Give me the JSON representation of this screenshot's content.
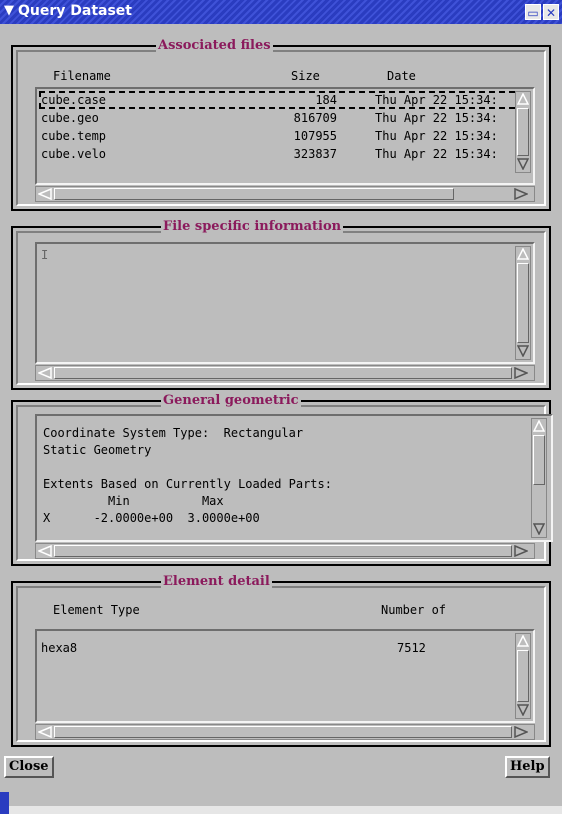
{
  "window": {
    "title": "Query Dataset",
    "minimize_glyph": "▭",
    "close_glyph": "✕",
    "menu_glyph": "▼"
  },
  "assoc": {
    "legend": "Associated files",
    "headers": {
      "filename": "Filename",
      "size": "Size",
      "date": "Date"
    },
    "rows": [
      {
        "filename": "cube.case",
        "size": "184",
        "date": "Thu Apr 22 15:34:"
      },
      {
        "filename": "cube.geo",
        "size": "816709",
        "date": "Thu Apr 22 15:34:"
      },
      {
        "filename": "cube.temp",
        "size": "107955",
        "date": "Thu Apr 22 15:34:"
      },
      {
        "filename": "cube.velo",
        "size": "323837",
        "date": "Thu Apr 22 15:34:"
      }
    ]
  },
  "filespec": {
    "legend": "File specific information",
    "text": ""
  },
  "geom": {
    "legend": "General geometric",
    "lines": [
      "Coordinate System Type:  Rectangular",
      "Static Geometry",
      "",
      "Extents Based on Currently Loaded Parts:",
      "         Min          Max",
      "X      -2.0000e+00  3.0000e+00"
    ]
  },
  "elem": {
    "legend": "Element detail",
    "headers": {
      "type": "Element Type",
      "count": "Number of"
    },
    "rows": [
      {
        "type": "hexa8",
        "count": "7512"
      }
    ]
  },
  "buttons": {
    "close": "Close",
    "help": "Help"
  }
}
